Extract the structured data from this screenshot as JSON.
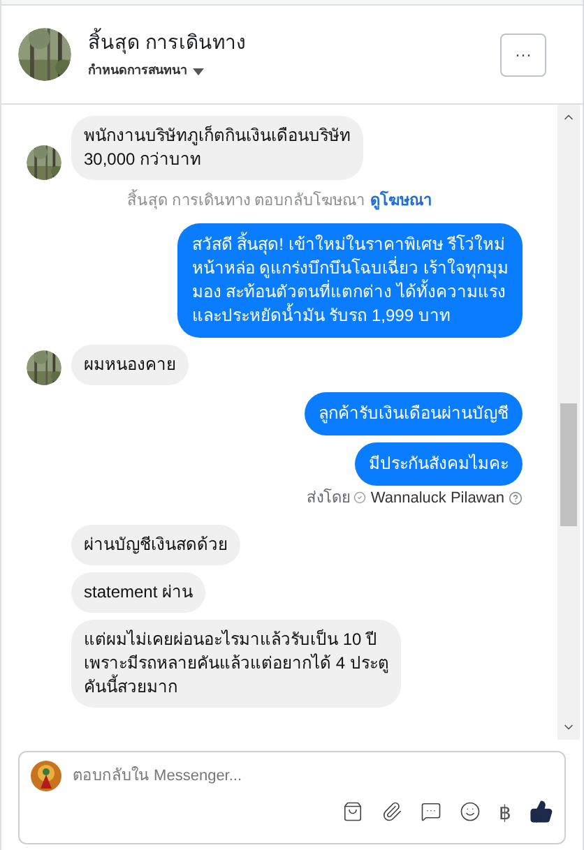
{
  "header": {
    "name": "สิ้นสุด การเดินทาง",
    "subtitle": "กำหนดการสนทนา",
    "more_button": "···"
  },
  "messages": [
    {
      "kind": "incoming",
      "avatar": true,
      "lines": [
        "พนักงานบริษัทภูเก็ตกินเงินเดือนบริษัท",
        "30,000 กว่าบาท"
      ]
    },
    {
      "kind": "notice",
      "text": "สิ้นสุด การเดินทาง ตอบกลับโฆษณา",
      "link": "ดูโฆษณา"
    },
    {
      "kind": "outgoing",
      "lines": [
        "สวัสดี สิ้นสุด! เข้าใหม่ในราคาพิเศษ รีโว่ใหม่",
        "หน้าหล่อ ดูแกร่งบึกบึนโฉบเฉี่ยว เร้าใจทุกมุม",
        "มอง สะท้อนตัวตนที่แตกต่าง ได้ทั้งความแรง",
        "และประหยัดน้ำมัน รับรถ 1,999 บาท"
      ]
    },
    {
      "kind": "incoming",
      "avatar": true,
      "lines": [
        "ผมหนองคาย"
      ]
    },
    {
      "kind": "outgoing",
      "lines": [
        "ลูกค้ารับเงินเดือนผ่านบัญชี"
      ]
    },
    {
      "kind": "outgoing",
      "lines": [
        "มีประกันสังคมไมคะ"
      ]
    },
    {
      "kind": "sender",
      "text": "ส่งโดย",
      "name": "Wannaluck Pilawan"
    },
    {
      "kind": "incoming",
      "avatar": false,
      "lines": [
        "ผ่านบัญชีเงินสดด้วย"
      ]
    },
    {
      "kind": "incoming",
      "avatar": false,
      "lines": [
        "statement ผ่าน"
      ]
    },
    {
      "kind": "incoming",
      "avatar": false,
      "lines": [
        "แต่ผมไม่เคยผ่อนอะไรมาแล้วรับเป็น 10 ปี",
        "เพราะมีรถหลายคันแล้วแต่อยากได้ 4 ประตู",
        "คันนี้สวยมาก"
      ]
    }
  ],
  "composer": {
    "placeholder": "ตอบกลับใน Messenger...",
    "currency_symbol": "฿"
  }
}
